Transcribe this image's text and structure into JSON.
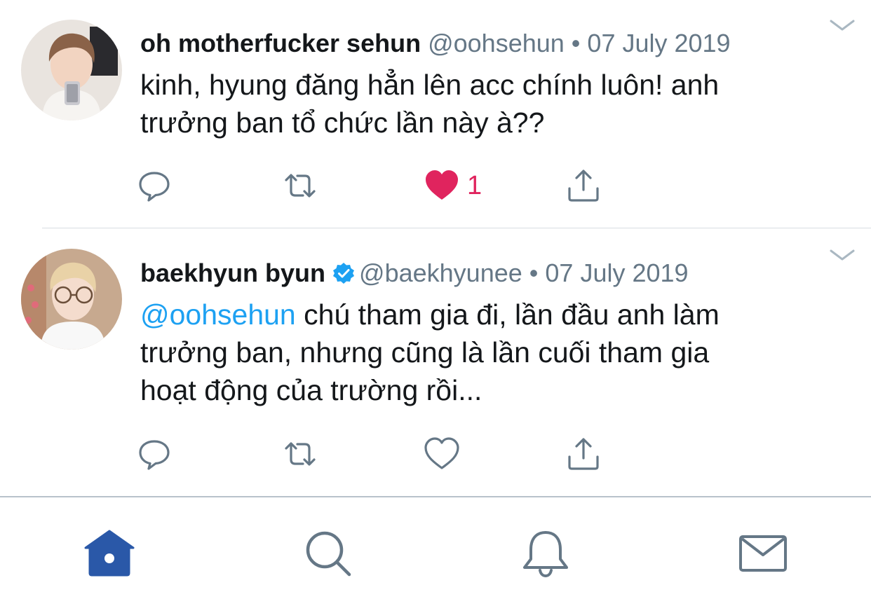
{
  "colors": {
    "accent": "#1da1f2",
    "like_active": "#e0245e",
    "text_primary": "#14171a",
    "text_secondary": "#657786",
    "icon_gray": "#657786",
    "home_active": "#2a58a8"
  },
  "tweets": [
    {
      "display_name": "oh motherfucker sehun",
      "verified": false,
      "handle": "@oohsehun",
      "separator": "•",
      "date": "07 July 2019",
      "mention": "",
      "text_lines": [
        "kinh, hyung đăng hẳn lên acc chính luôn! anh",
        "trưởng ban tổ chức lần này à??"
      ],
      "liked": true,
      "like_count": "1",
      "icons": [
        "reply-icon",
        "retweet-icon",
        "heart-filled-icon",
        "share-icon",
        "chevron-down-icon"
      ]
    },
    {
      "display_name": "baekhyun byun",
      "verified": true,
      "handle": "@baekhyunee",
      "separator": "•",
      "date": "07 July 2019",
      "mention": "@oohsehun",
      "first_line_rest": " chú tham gia đi, lần đầu anh làm",
      "text_lines": [
        "trưởng ban, nhưng cũng là lần cuối tham gia",
        "hoạt động của trường rồi..."
      ],
      "liked": false,
      "like_count": "",
      "icons": [
        "reply-icon",
        "retweet-icon",
        "heart-outline-icon",
        "share-icon",
        "chevron-down-icon",
        "verified-badge-icon"
      ]
    }
  ],
  "tab_bar": {
    "items": [
      {
        "icon": "home-icon",
        "active": true
      },
      {
        "icon": "search-icon",
        "active": false
      },
      {
        "icon": "bell-icon",
        "active": false
      },
      {
        "icon": "mail-icon",
        "active": false
      }
    ]
  }
}
